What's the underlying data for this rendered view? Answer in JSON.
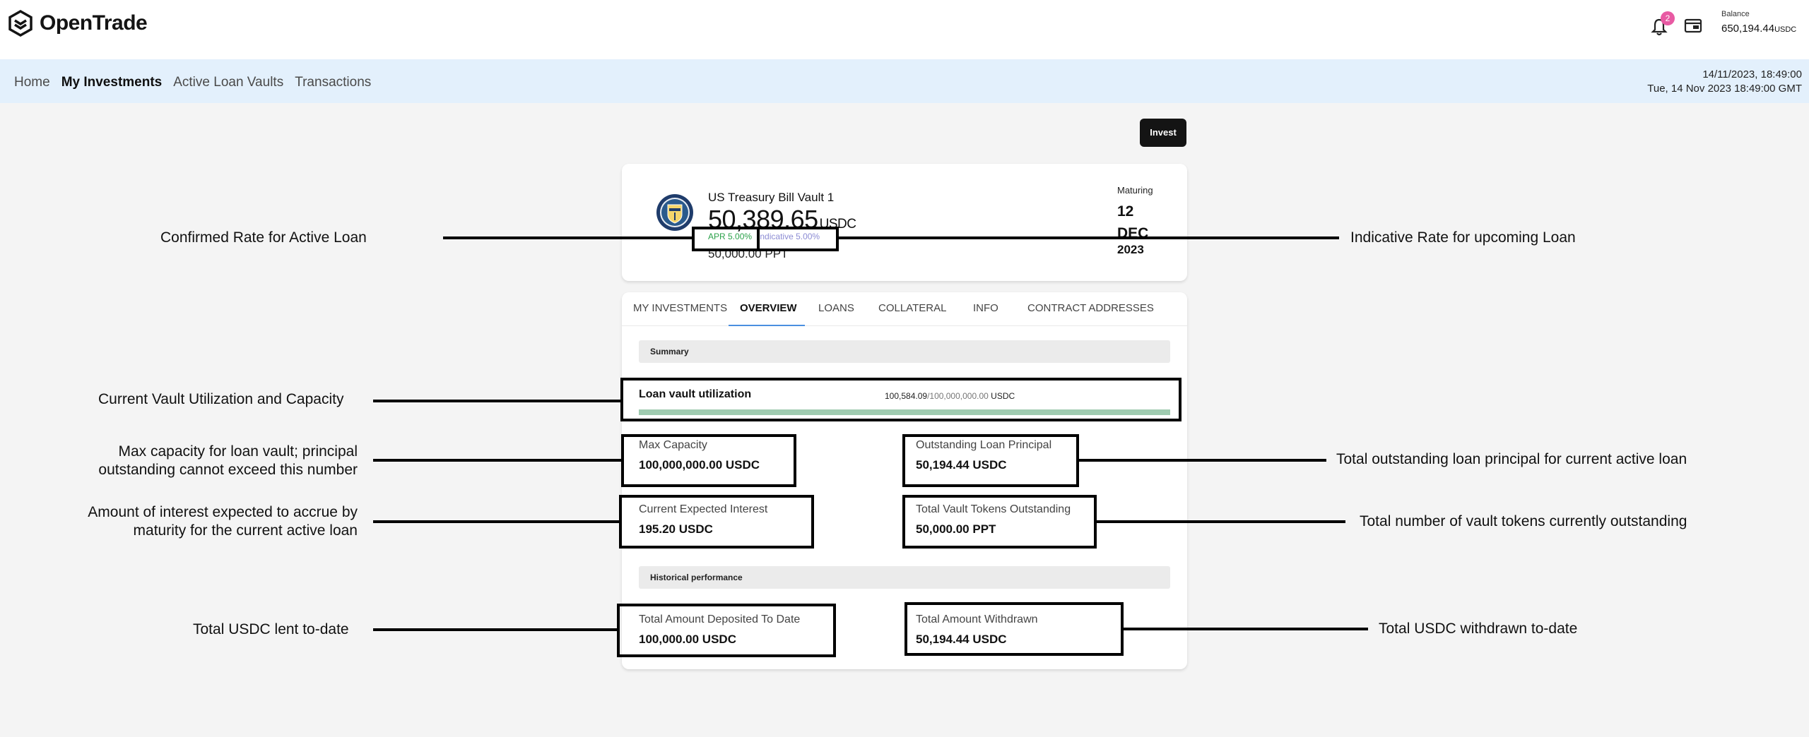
{
  "header": {
    "logo_text": "OpenTrade",
    "notification_count": "2",
    "balance_label": "Balance",
    "balance_value": "650,194.44",
    "balance_unit": "USDC"
  },
  "nav": {
    "items": [
      "Home",
      "My Investments",
      "Active Loan Vaults",
      "Transactions"
    ],
    "active_index": 1,
    "date_short": "14/11/2023, 18:49:00",
    "date_long": "Tue, 14 Nov 2023 18:49:00 GMT"
  },
  "invest_button": "Invest",
  "vault": {
    "name": "US Treasury Bill Vault 1",
    "amount": "50,389.65",
    "amount_unit": "USDC",
    "apr": "APR 5.00%",
    "indicative": "Indicative 5.00%",
    "ppt": "50,000.00 PPT",
    "maturing_label": "Maturing",
    "maturing_day_month": "12 DEC",
    "maturing_year": "2023"
  },
  "tabs": [
    "MY INVESTMENTS",
    "OVERVIEW",
    "LOANS",
    "COLLATERAL",
    "INFO",
    "CONTRACT ADDRESSES"
  ],
  "summary": {
    "section_title": "Summary",
    "utilization_label": "Loan vault utilization",
    "utilization_used": "100,584.09",
    "utilization_capacity": "/100,000,000.00",
    "utilization_unit": " USDC",
    "utilization_fraction": 0.001,
    "max_capacity_label": "Max Capacity",
    "max_capacity_value": "100,000,000.00 USDC",
    "outstanding_label": "Outstanding Loan Principal",
    "outstanding_value": "50,194.44 USDC",
    "interest_label": "Current Expected Interest",
    "interest_value": "195.20 USDC",
    "tokens_label": "Total Vault Tokens Outstanding",
    "tokens_value": "50,000.00 PPT"
  },
  "historical": {
    "section_title": "Historical performance",
    "deposited_label": "Total Amount Deposited To Date",
    "deposited_value": "100,000.00 USDC",
    "withdrawn_label": "Total Amount Withdrawn",
    "withdrawn_value": "50,194.44 USDC"
  },
  "annotations": {
    "confirmed_rate": "Confirmed Rate for Active Loan",
    "indicative_rate": "Indicative Rate for upcoming Loan",
    "utilization": "Current Vault Utilization and Capacity",
    "max_capacity_1": "Max capacity for loan vault; principal",
    "max_capacity_2": "outstanding cannot exceed this number",
    "outstanding": "Total outstanding loan principal for current active loan",
    "interest_1": "Amount of interest expected to accrue by",
    "interest_2": "maturity for the current active loan",
    "tokens": "Total number of vault tokens currently outstanding",
    "lent": "Total USDC lent to-date",
    "withdrawn": "Total USDC withdrawn to-date"
  }
}
